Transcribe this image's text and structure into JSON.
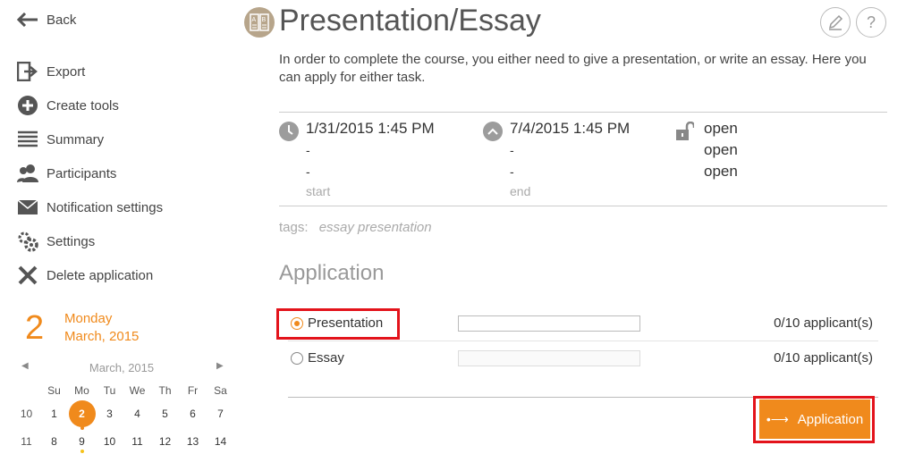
{
  "sidebar": {
    "back_label": "Back",
    "items": [
      {
        "label": "Export",
        "icon": "export-icon"
      },
      {
        "label": "Create tools",
        "icon": "plus-circle-icon"
      },
      {
        "label": "Summary",
        "icon": "list-icon"
      },
      {
        "label": "Participants",
        "icon": "users-icon"
      },
      {
        "label": "Notification settings",
        "icon": "envelope-icon"
      },
      {
        "label": "Settings",
        "icon": "gears-icon"
      },
      {
        "label": "Delete application",
        "icon": "close-icon"
      }
    ]
  },
  "date_widget": {
    "day_number": "2",
    "weekday": "Monday",
    "month_year": "March, 2015"
  },
  "calendar": {
    "title": "March, 2015",
    "weekdays": [
      "Su",
      "Mo",
      "Tu",
      "We",
      "Th",
      "Fr",
      "Sa"
    ],
    "weeks": [
      {
        "week": "10",
        "days": [
          "1",
          "2",
          "3",
          "4",
          "5",
          "6",
          "7"
        ]
      },
      {
        "week": "11",
        "days": [
          "8",
          "9",
          "10",
          "11",
          "12",
          "13",
          "14"
        ]
      }
    ],
    "selected_day": "2",
    "accent_color": "#f08a1c"
  },
  "header": {
    "title": "Presentation/Essay",
    "description": "In order to complete the course, you either need to give a presentation, or write an essay. Here you can apply for either task."
  },
  "schedule": {
    "start": {
      "value": "1/31/2015 1:45 PM",
      "line2": "-",
      "line3": "-",
      "label": "start"
    },
    "end": {
      "value": "7/4/2015 1:45 PM",
      "line2": "-",
      "line3": "-",
      "label": "end"
    },
    "status": {
      "line1": "open",
      "line2": "open",
      "line3": "open"
    }
  },
  "tags": {
    "label": "tags:",
    "value": "essay presentation"
  },
  "application": {
    "section_title": "Application",
    "options": [
      {
        "label": "Presentation",
        "count": "0/10 applicant(s)",
        "selected": true
      },
      {
        "label": "Essay",
        "count": "0/10 applicant(s)",
        "selected": false
      }
    ],
    "submit_label": "Application"
  },
  "colors": {
    "accent": "#f08a1c",
    "highlight": "#e3131b"
  }
}
